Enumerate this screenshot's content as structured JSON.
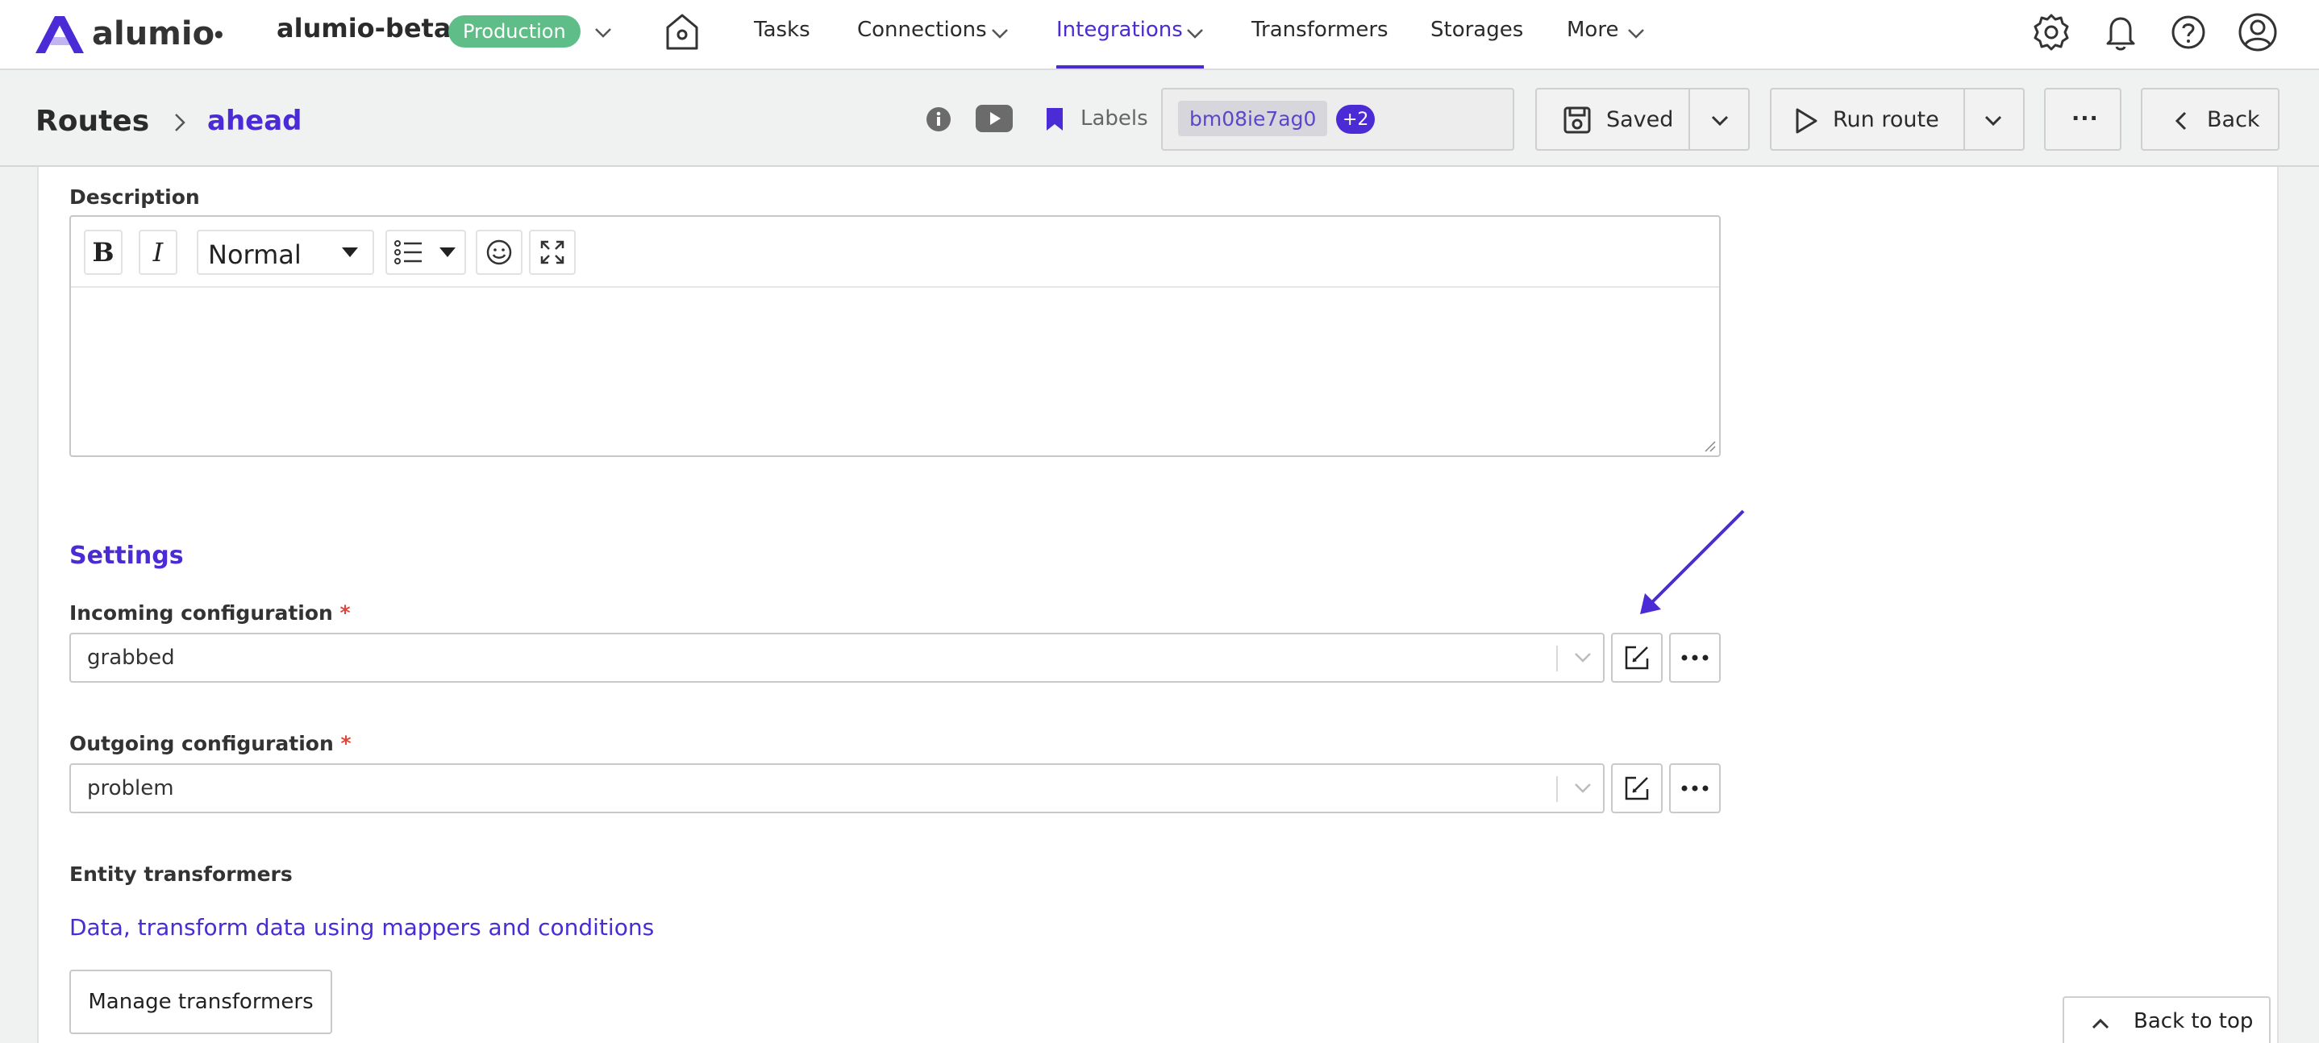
{
  "brand": {
    "name": "alumio",
    "accent": "#4a2bd6"
  },
  "topnav": {
    "workspace": "alumio-beta",
    "environment": "Production",
    "items": [
      {
        "label": "Tasks"
      },
      {
        "label": "Connections"
      },
      {
        "label": "Integrations",
        "active": true
      },
      {
        "label": "Transformers"
      },
      {
        "label": "Storages"
      },
      {
        "label": "More"
      }
    ],
    "icons": [
      "home-icon",
      "gear-icon",
      "bell-icon",
      "help-icon",
      "user-icon"
    ]
  },
  "subheader": {
    "breadcrumb_root": "Routes",
    "breadcrumb_current": "ahead",
    "labels_text": "Labels",
    "label_chip": "bm08ie7ag0",
    "label_extra_count": "+2",
    "saved_label": "Saved",
    "run_label": "Run route",
    "more_label": "...",
    "back_label": "Back"
  },
  "form": {
    "description_label": "Description",
    "editor": {
      "format_value": "Normal"
    },
    "settings_title": "Settings",
    "incoming": {
      "label": "Incoming configuration",
      "required": "*",
      "value": "grabbed"
    },
    "outgoing": {
      "label": "Outgoing configuration",
      "required": "*",
      "value": "problem"
    },
    "entity_transformers_label": "Entity transformers",
    "entity_transformers_link": "Data, transform data using mappers and conditions",
    "manage_button": "Manage transformers",
    "back_to_top": "Back to top"
  }
}
